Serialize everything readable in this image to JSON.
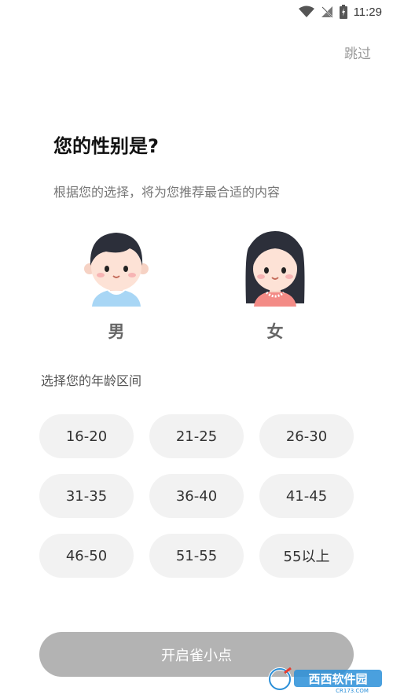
{
  "status_bar": {
    "time": "11:29",
    "icons": [
      "wifi-icon",
      "no-signal-icon",
      "battery-icon"
    ]
  },
  "skip_label": "跳过",
  "title": "您的性别是?",
  "subtitle": "根据您的选择，将为您推荐最合适的内容",
  "genders": [
    {
      "label": "男",
      "icon": "boy-avatar-icon"
    },
    {
      "label": "女",
      "icon": "girl-avatar-icon"
    }
  ],
  "age_section_title": "选择您的年龄区间",
  "age_options": [
    "16-20",
    "21-25",
    "26-30",
    "31-35",
    "36-40",
    "41-45",
    "46-50",
    "51-55",
    "55以上"
  ],
  "start_button_label": "开启雀小点",
  "watermark": {
    "text": "西西软件园",
    "url_text": "CR173.COM"
  },
  "colors": {
    "button_bg": "#f2f2f2",
    "start_button_bg": "#b3b3b3",
    "text_secondary": "#777777",
    "skip_text": "#9a9a9a"
  }
}
